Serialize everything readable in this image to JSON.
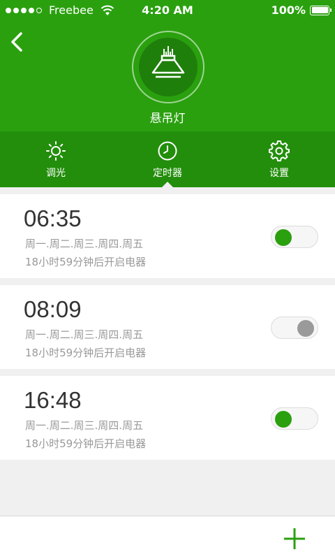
{
  "statusbar": {
    "carrier": "Freebee",
    "time": "4:20 AM",
    "battery": "100%"
  },
  "device": {
    "name": "悬吊灯",
    "icon": "pendant-lamp-icon"
  },
  "tabs": [
    {
      "label": "调光",
      "icon": "sun-icon"
    },
    {
      "label": "定时器",
      "icon": "clock-icon",
      "active": true
    },
    {
      "label": "设置",
      "icon": "gear-icon"
    }
  ],
  "timers": [
    {
      "time": "06:35",
      "days": "周一.周二.周三.周四.周五",
      "remaining": "18小时59分钟后开启电器",
      "enabled": true
    },
    {
      "time": "08:09",
      "days": "周一.周二.周三.周四.周五",
      "remaining": "18小时59分钟后开启电器",
      "enabled": false
    },
    {
      "time": "16:48",
      "days": "周一.周二.周三.周四.周五",
      "remaining": "18小时59分钟后开启电器",
      "enabled": true
    }
  ],
  "colors": {
    "primary": "#2aa00f",
    "tab_bar": "#238e0c",
    "toggle_off": "#9a9a9a"
  }
}
